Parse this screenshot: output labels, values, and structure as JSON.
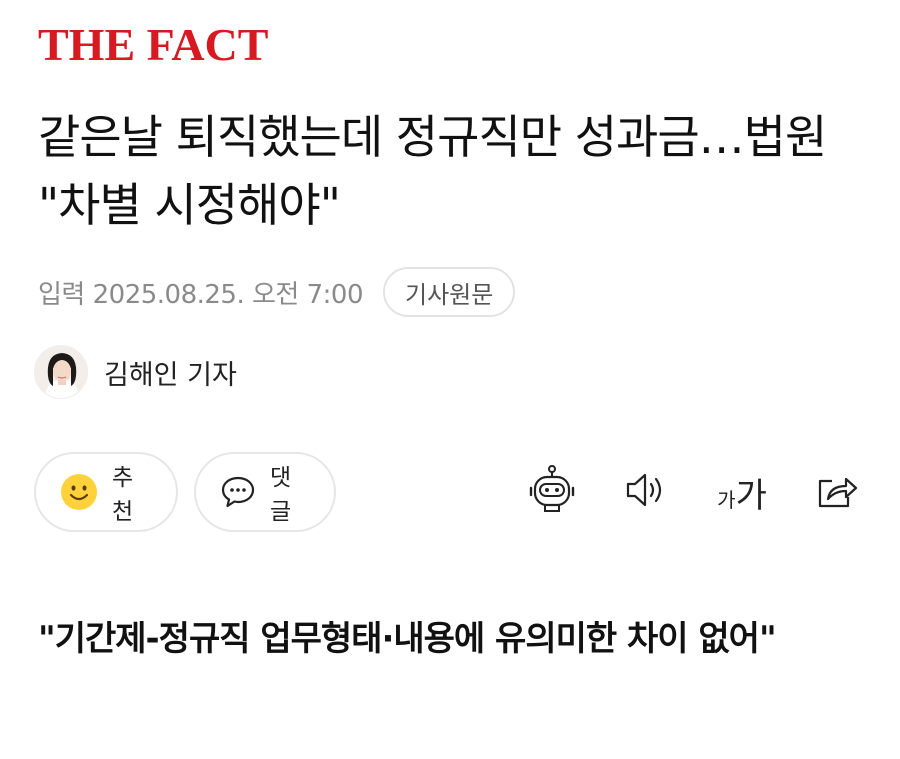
{
  "header": {
    "logo": "THE FACT"
  },
  "article": {
    "title": "같은날 퇴직했는데 정규직만 성과금…법원 \"차별 시정해야\"",
    "date": "입력 2025.08.25. 오전 7:00",
    "original_link": "기사원문",
    "reporter": "김해인 기자",
    "subtitle": "\"기간제-정규직 업무형태·내용에 유의미한 차이 없어\""
  },
  "actions": {
    "recommend": "추천",
    "comment": "댓글"
  },
  "tools": {
    "font_small": "가",
    "font_big": "가"
  },
  "colors": {
    "brand": "#d71a21",
    "muted": "#8a8a8a",
    "border": "#e3e3e3"
  },
  "icons": [
    "smile-icon",
    "speech-bubble-icon",
    "robot-icon",
    "speaker-icon",
    "font-size-icon",
    "share-icon"
  ]
}
